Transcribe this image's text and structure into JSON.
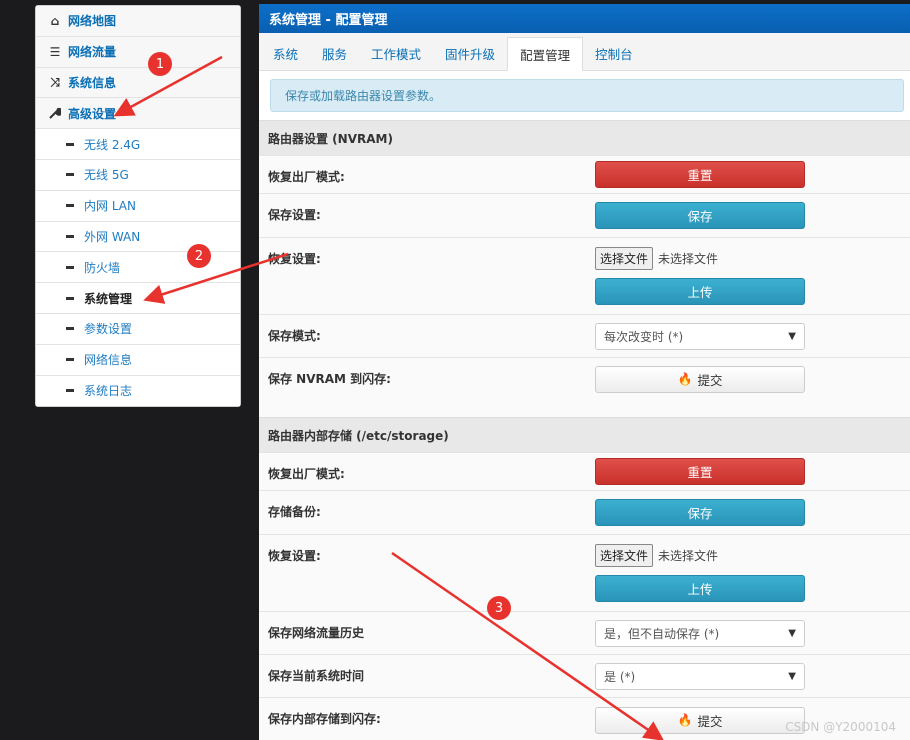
{
  "sidebar": {
    "items": [
      {
        "icon": "home-icon",
        "glyph": "⌂",
        "label": "网络地图"
      },
      {
        "icon": "list-icon",
        "glyph": "☰",
        "label": "网络流量"
      },
      {
        "icon": "shuffle-icon",
        "glyph": "⤨",
        "label": "系统信息"
      },
      {
        "icon": "wrench-icon",
        "glyph": "🔧",
        "label": "高级设置"
      }
    ],
    "subitems": [
      {
        "label": "无线 2.4G"
      },
      {
        "label": "无线 5G"
      },
      {
        "label": "内网 LAN"
      },
      {
        "label": "外网 WAN"
      },
      {
        "label": "防火墙"
      },
      {
        "label": "系统管理"
      },
      {
        "label": "参数设置"
      },
      {
        "label": "网络信息"
      },
      {
        "label": "系统日志"
      }
    ]
  },
  "main": {
    "title": "系统管理 - 配置管理",
    "tabs": [
      "系统",
      "服务",
      "工作模式",
      "固件升级",
      "配置管理",
      "控制台"
    ],
    "active_tab": "配置管理",
    "alert": "保存或加载路由器设置参数。",
    "nvram": {
      "heading": "路由器设置 (NVRAM)",
      "factory_label": "恢复出厂模式:",
      "factory_btn": "重置",
      "save_label": "保存设置:",
      "save_btn": "保存",
      "restore_label": "恢复设置:",
      "file_btn": "选择文件",
      "file_name": "未选择文件",
      "upload_btn": "上传",
      "mode_label": "保存模式:",
      "mode_value": "每次改变时 (*)",
      "commit_label": "保存 NVRAM 到闪存:",
      "commit_btn": "提交"
    },
    "storage": {
      "heading": "路由器内部存储 (/etc/storage)",
      "factory_label": "恢复出厂模式:",
      "factory_btn": "重置",
      "backup_label": "存储备份:",
      "backup_btn": "保存",
      "restore_label": "恢复设置:",
      "file_btn": "选择文件",
      "file_name": "未选择文件",
      "upload_btn": "上传",
      "traffic_label": "保存网络流量历史",
      "traffic_value": "是，但不自动保存 (*)",
      "time_label": "保存当前系统时间",
      "time_value": "是 (*)",
      "commit_label": "保存内部存储到闪存:",
      "commit_btn": "提交"
    }
  },
  "annotations": {
    "marker1": "1",
    "marker2": "2",
    "marker3": "3"
  },
  "watermark": "CSDN @Y2000104",
  "colors": {
    "title_bar": "#0a66bf",
    "danger": "#d9534f",
    "info": "#31a0c6",
    "marker": "#e8322d"
  }
}
